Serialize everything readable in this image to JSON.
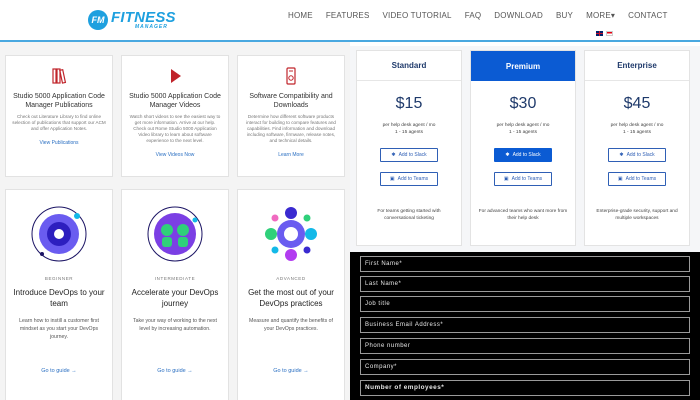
{
  "header": {
    "logo_badge": "FM",
    "logo_main": "FITNESS",
    "logo_sub": "MANAGER",
    "nav": [
      "HOME",
      "FEATURES",
      "VIDEO TUTORIAL",
      "FAQ",
      "DOWNLOAD",
      "BUY",
      "MORE▾",
      "CONTACT"
    ],
    "accent": "#1ea0df"
  },
  "publications": [
    {
      "title": "Studio 5000 Application Code Manager Publications",
      "desc": "Check out Literature Library to find online selection of publications that support our ACM and offer Application Notes.",
      "link": "View Publications",
      "icon": "books-icon"
    },
    {
      "title": "Studio 5000 Application Code Manager Videos",
      "desc": "Watch short videos to see the easiest way to get more information. Arrive at our help. Check out Rome Studio 5000 Application Video library to learn about software experience to the next level.",
      "link": "View Videos Now",
      "icon": "play-icon"
    },
    {
      "title": "Software Compatibility and Downloads",
      "desc": "Determine how different software products interact for building to compare features and capabilities. Find information and download including software, firmware, release notes, and technical details.",
      "link": "Learn More",
      "icon": "download-icon"
    }
  ],
  "devops": [
    {
      "level": "BEGINNER",
      "title": "Introduce DevOps to your team",
      "desc": "Learn how to instill a customer first mindset as you start your DevOps journey.",
      "link": "Go to guide →"
    },
    {
      "level": "INTERMEDIATE",
      "title": "Accelerate your DevOps journey",
      "desc": "Take your way of working to the next level by increasing automation.",
      "link": "Go to guide →"
    },
    {
      "level": "ADVANCED",
      "title": "Get the most out of your DevOps practices",
      "desc": "Measure and quantify the benefits of your DevOps practices.",
      "link": "Go to guide →"
    }
  ],
  "pricing": [
    {
      "name": "Standard",
      "price": "$15",
      "unit_line1": "per help desk agent / mo",
      "unit_line2": "1 - 15 agents",
      "slack": "Add to Slack",
      "teams": "Add to Teams",
      "desc": "For teams getting started with conversational ticketing"
    },
    {
      "name": "Premium",
      "price": "$30",
      "unit_line1": "per help desk agent / mo",
      "unit_line2": "1 - 15 agents",
      "slack": "Add to Slack",
      "teams": "Add to Teams",
      "desc": "For advanced teams who want more from their help desk"
    },
    {
      "name": "Enterprise",
      "price": "$45",
      "unit_line1": "per help desk agent / mo",
      "unit_line2": "1 - 15 agents",
      "slack": "Add to Slack",
      "teams": "Add to Teams",
      "desc": "Enterprise-grade security, support and multiple workspaces"
    }
  ],
  "form_fields": [
    "First Name*",
    "Last Name*",
    "Job title",
    "Business Email Address*",
    "Phone number",
    "Company*",
    "Number of employees*"
  ],
  "colors": {
    "premium": "#0b5bd3",
    "link": "#2a6fc2",
    "form_bg": "#000000"
  }
}
